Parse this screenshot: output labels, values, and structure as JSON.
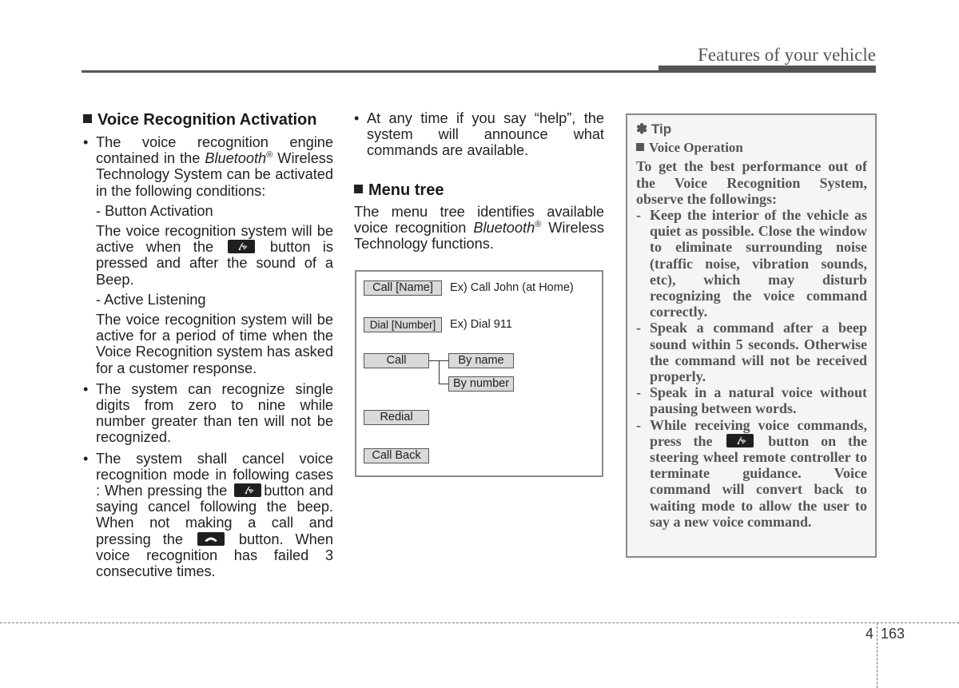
{
  "header": {
    "title": "Features of your vehicle"
  },
  "left_column": {
    "heading": "Voice Recognition Activation",
    "bullet1": {
      "text_a": "The voice recognition engine contained in the ",
      "brand": "Bluetooth",
      "reg": "®",
      "text_b": " Wireless Technology System can be activated in the following conditions:"
    },
    "sub1_title": "- Button Activation",
    "sub1_text_a": "The voice recognition system will be active when the",
    "sub1_text_b": "button is pressed and after the sound of a Beep.",
    "sub2_title": "- Active Listening",
    "sub2_text": "The voice recognition system will be active for a period of time when the Voice Recognition system has asked for a customer response.",
    "bullet2": "The system can recognize single digits from zero to nine while number greater than ten will not be recognized.",
    "bullet3_a": "The system shall cancel voice recognition mode in following cases : When pressing the",
    "bullet3_b": "button and saying cancel following the beep. When not making a call and pressing the",
    "bullet3_c": "button. When voice recognition has failed 3 consecutive times.",
    "bullet_char": "•"
  },
  "middle_column": {
    "bullet1": "At any time if you say “help”, the system will announce what commands are available.",
    "heading": "Menu tree",
    "intro_a": "The menu tree identifies available voice recognition ",
    "brand": "Bluetooth",
    "reg": "®",
    "intro_b": " Wireless Technology functions."
  },
  "menu_tree": {
    "items": [
      {
        "label": "Call [Name]",
        "example": "Ex) Call John (at Home)"
      },
      {
        "label": "Dial [Number]",
        "example": "Ex) Dial 911"
      },
      {
        "label": "Call",
        "children": [
          "By name",
          "By number"
        ]
      },
      {
        "label": "Redial"
      },
      {
        "label": "Call Back"
      }
    ]
  },
  "tip": {
    "marker": "✽",
    "title": "Tip",
    "subtitle": "Voice Operation",
    "intro": "To get the best performance out of the Voice Recognition System, observe the followings:",
    "items": [
      "Keep the interior of the vehicle as quiet as possible. Close the window to eliminate surrounding noise (traffic noise, vibration sounds, etc), which may disturb recognizing the voice command correctly.",
      "Speak a command after a beep sound within 5 seconds. Otherwise the command will not be received properly.",
      "Speak in a natural voice without pausing between words."
    ],
    "item4_a": "While receiving voice commands, press the",
    "item4_b": "button on the steering wheel remote controller to terminate guidance. Voice command will convert back to waiting mode to allow the user to say a new voice command.",
    "dash": "-"
  },
  "icons": {
    "voice_button": "talk-button-icon",
    "end_call_button": "hang-up-button-icon"
  },
  "footer": {
    "chapter": "4",
    "page": "163"
  }
}
